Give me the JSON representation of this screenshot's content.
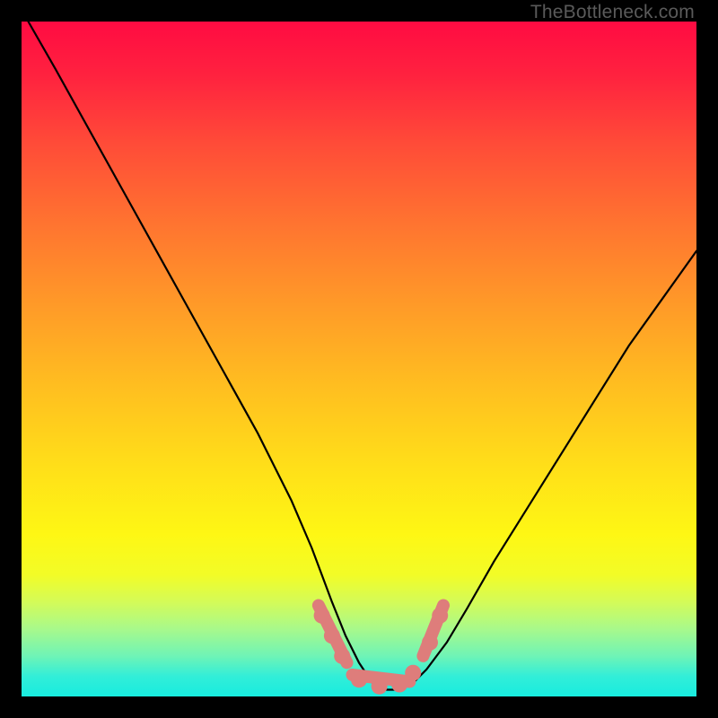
{
  "attribution": "TheBottleneck.com",
  "chart_data": {
    "type": "line",
    "title": "",
    "xlabel": "",
    "ylabel": "",
    "xlim": [
      0,
      100
    ],
    "ylim": [
      0,
      100
    ],
    "grid": false,
    "legend": false,
    "series": [
      {
        "name": "bottleneck-curve",
        "color": "#000000",
        "x": [
          1,
          5,
          10,
          15,
          20,
          25,
          30,
          35,
          40,
          43,
          46,
          48,
          50,
          52,
          54,
          56,
          58,
          60,
          63,
          66,
          70,
          75,
          80,
          85,
          90,
          95,
          100
        ],
        "y": [
          100,
          93,
          84,
          75,
          66,
          57,
          48,
          39,
          29,
          22,
          14,
          9,
          5,
          2,
          1,
          1,
          2,
          4,
          8,
          13,
          20,
          28,
          36,
          44,
          52,
          59,
          66
        ]
      }
    ],
    "markers": [
      {
        "name": "left-upper-dot",
        "x": 44.5,
        "y": 12,
        "r": 1.2,
        "color": "#de7d7b"
      },
      {
        "name": "left-mid-dot",
        "x": 46.0,
        "y": 9,
        "r": 1.2,
        "color": "#de7d7b"
      },
      {
        "name": "left-lower-dot",
        "x": 47.5,
        "y": 6,
        "r": 1.2,
        "color": "#de7d7b"
      },
      {
        "name": "trough-left-dot",
        "x": 50.0,
        "y": 2.5,
        "r": 1.2,
        "color": "#de7d7b"
      },
      {
        "name": "trough-mid-dot",
        "x": 53.0,
        "y": 1.5,
        "r": 1.2,
        "color": "#de7d7b"
      },
      {
        "name": "trough-right-dot",
        "x": 56.0,
        "y": 1.8,
        "r": 1.2,
        "color": "#de7d7b"
      },
      {
        "name": "right-lower-dot",
        "x": 58.0,
        "y": 3.5,
        "r": 1.2,
        "color": "#de7d7b"
      },
      {
        "name": "right-mid-dot",
        "x": 60.5,
        "y": 8,
        "r": 1.2,
        "color": "#de7d7b"
      },
      {
        "name": "right-upper-dot",
        "x": 62.0,
        "y": 12,
        "r": 1.2,
        "color": "#de7d7b"
      }
    ],
    "marker_segments": [
      {
        "name": "left-descent-segment",
        "x": [
          44.0,
          48.2
        ],
        "y": [
          13.5,
          5.0
        ],
        "stroke": "#de7d7b",
        "width": 2.2
      },
      {
        "name": "trough-segment",
        "x": [
          49.0,
          57.5
        ],
        "y": [
          3.2,
          2.2
        ],
        "stroke": "#de7d7b",
        "width": 2.2
      },
      {
        "name": "right-ascent-segment",
        "x": [
          59.5,
          62.5
        ],
        "y": [
          6.0,
          13.5
        ],
        "stroke": "#de7d7b",
        "width": 2.2
      }
    ]
  }
}
